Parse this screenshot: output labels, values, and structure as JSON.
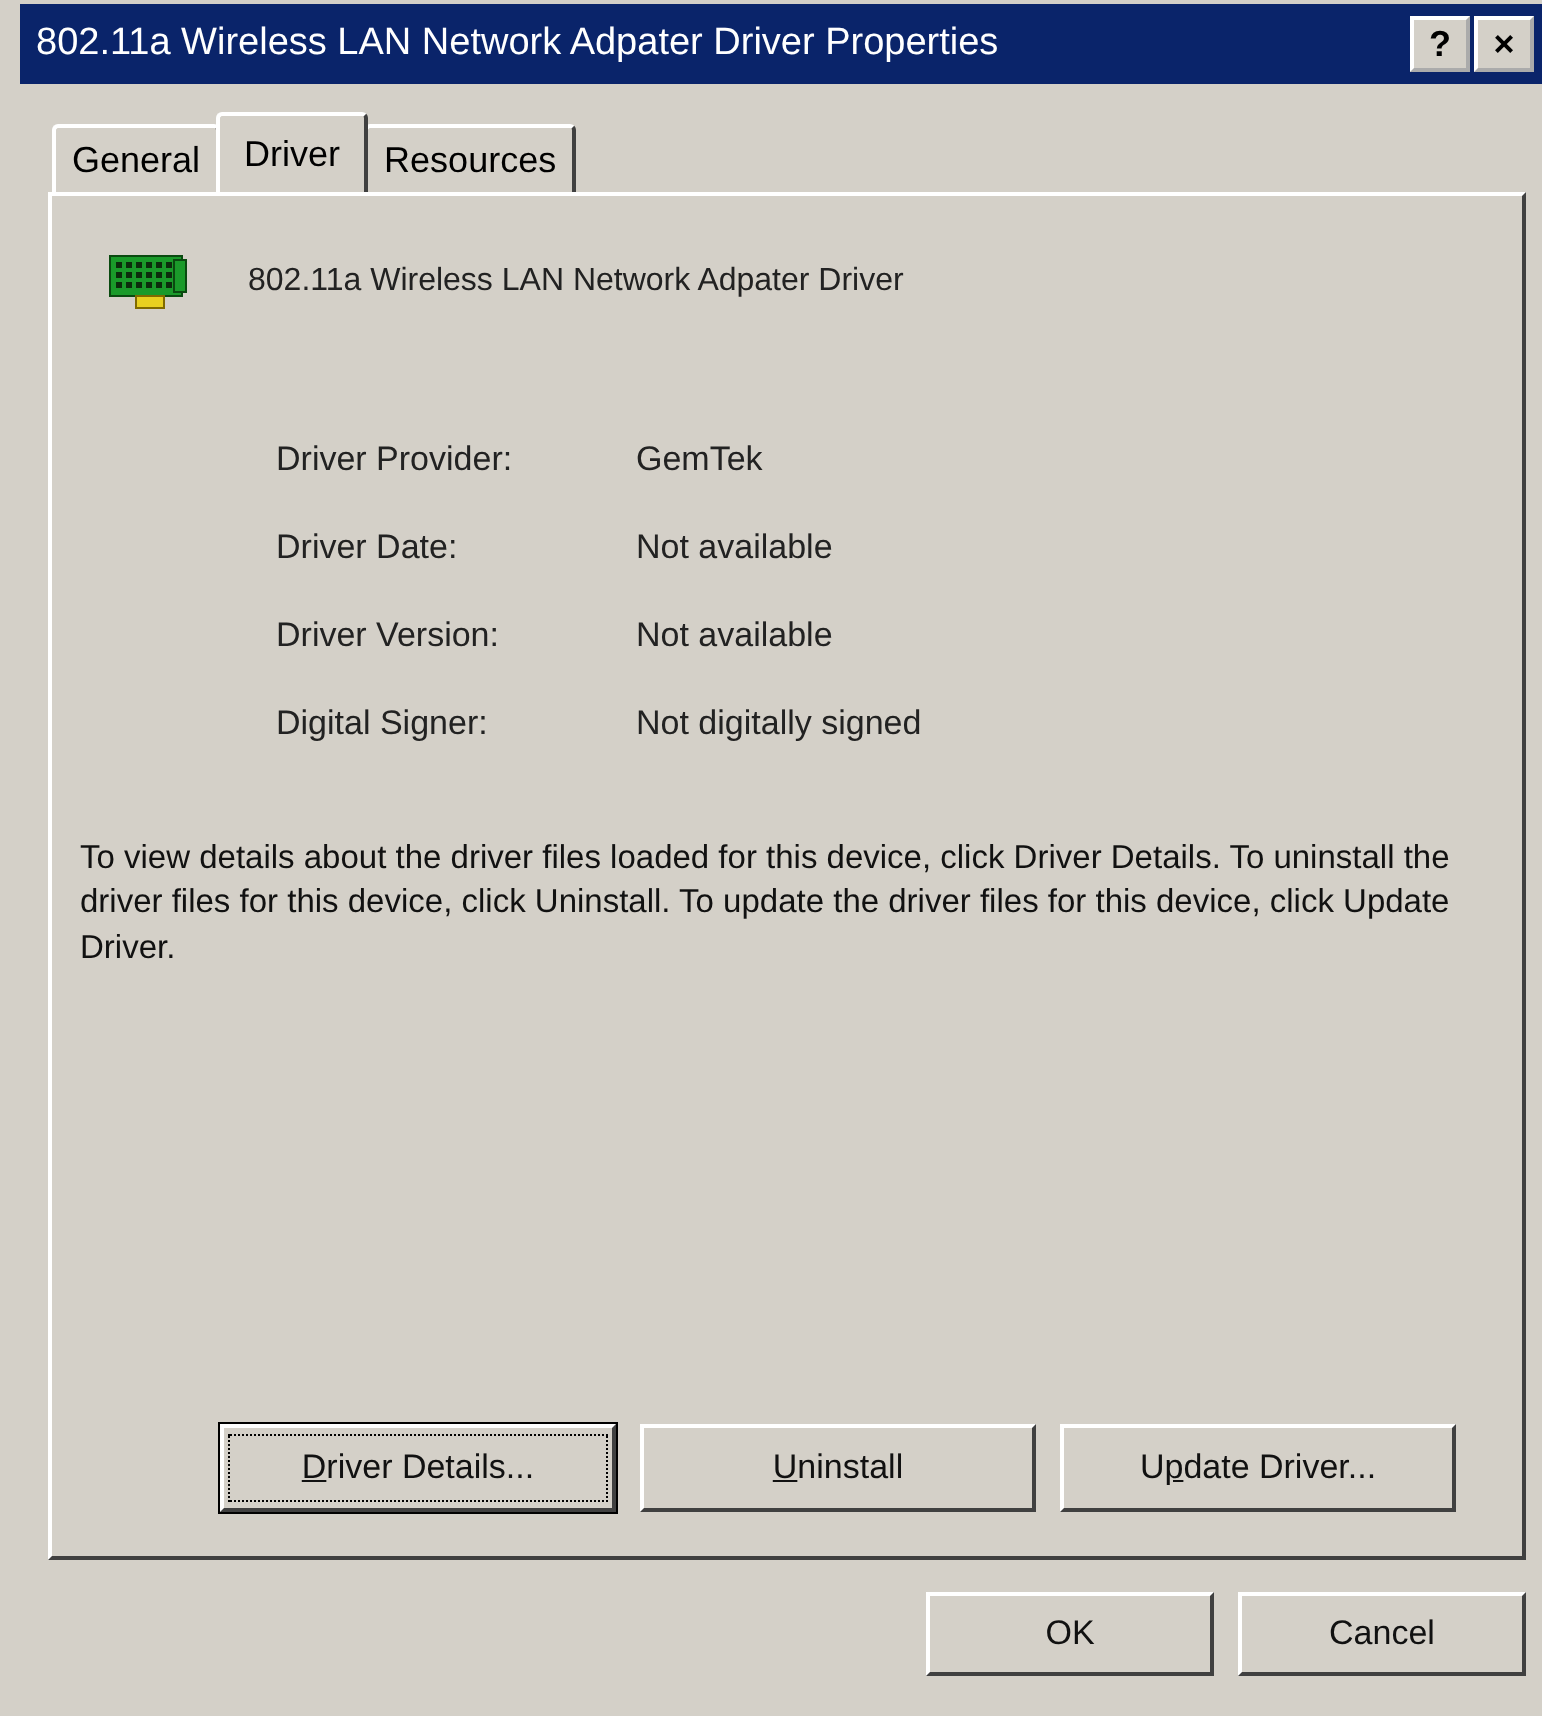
{
  "window": {
    "title": "802.11a Wireless LAN Network Adpater Driver Properties",
    "title_buttons": [
      "?",
      "×"
    ]
  },
  "tabs": [
    {
      "label": "General",
      "selected": false
    },
    {
      "label": "Driver",
      "selected": true
    },
    {
      "label": "Resources",
      "selected": false
    }
  ],
  "device": {
    "name": "802.11a Wireless LAN Network Adpater Driver"
  },
  "properties": [
    {
      "label": "Driver Provider:",
      "value": "GemTek"
    },
    {
      "label": "Driver Date:",
      "value": "Not available"
    },
    {
      "label": "Driver Version:",
      "value": "Not available"
    },
    {
      "label": "Digital Signer:",
      "value": "Not digitally signed"
    }
  ],
  "description": "To view details about the driver files loaded for this device, click Driver Details. To uninstall the driver files for this device, click Uninstall. To update the driver files for this device, click Update Driver.",
  "driver_buttons": [
    {
      "key": "D",
      "after": "river Details...",
      "focused": true
    },
    {
      "key": "U",
      "after": "ninstall",
      "focused": false
    },
    {
      "before": "U",
      "key": "p",
      "after": "date Driver...",
      "focused": false
    }
  ],
  "dialog_buttons": [
    "OK",
    "Cancel"
  ]
}
